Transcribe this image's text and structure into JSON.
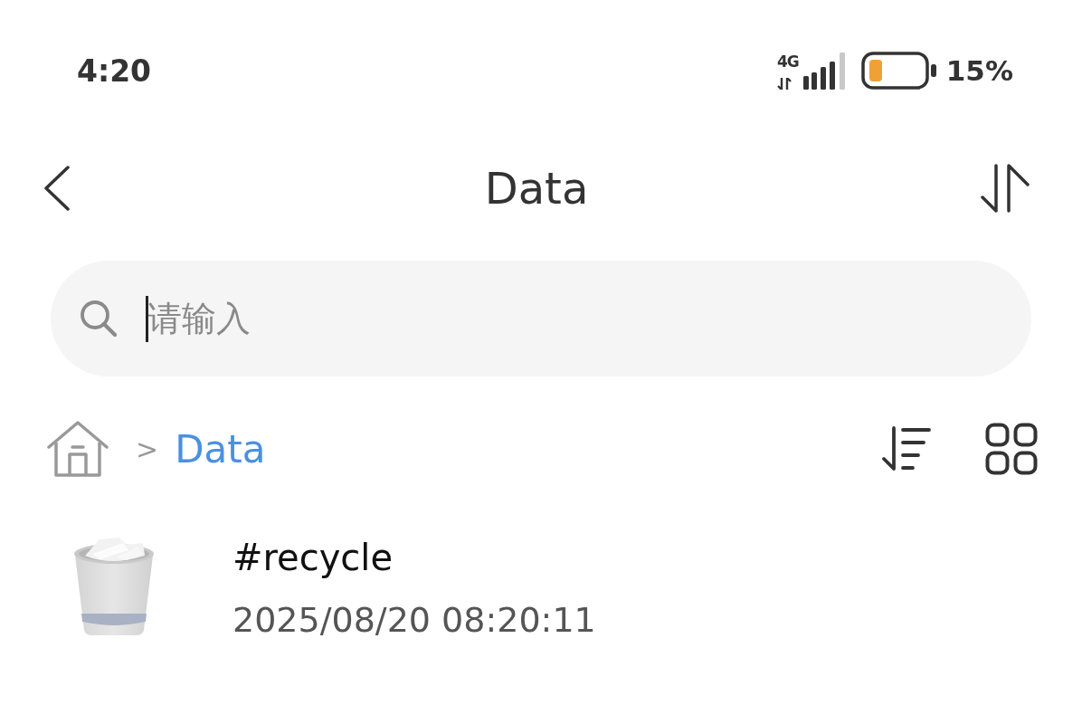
{
  "status_bar": {
    "time": "4:20",
    "network": "4G",
    "battery": "15%"
  },
  "header": {
    "title": "Data"
  },
  "search": {
    "placeholder": "请输入",
    "focused": true
  },
  "breadcrumb": {
    "items": [
      {
        "kind": "home",
        "selected": false
      },
      {
        "kind": "folder",
        "label": "Data",
        "selected": true
      }
    ],
    "separator": ">"
  },
  "files": [
    {
      "kind": "recycle",
      "name": "#recycle",
      "modified": "2025/08/20 08:20:11"
    }
  ]
}
